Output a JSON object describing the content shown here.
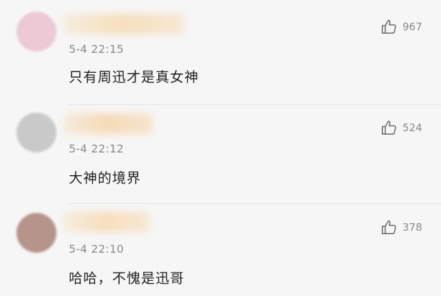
{
  "comments": [
    {
      "time": "5-4 22:15",
      "text": "只有周迅才是真女神",
      "likes": "967",
      "avatar_color": "#ecc9d5",
      "name_blur_color": "#f6dcb6"
    },
    {
      "time": "5-4 22:12",
      "text": "大神的境界",
      "likes": "524",
      "avatar_color": "#c9c9c9",
      "name_blur_color": "#f6d7b0"
    },
    {
      "time": "5-4 22:10",
      "text": "哈哈，不愧是迅哥",
      "likes": "378",
      "avatar_color": "#b6948a",
      "name_blur_color": "#f7dcb8"
    }
  ],
  "icons": {
    "like": "thumbs-up-icon"
  }
}
